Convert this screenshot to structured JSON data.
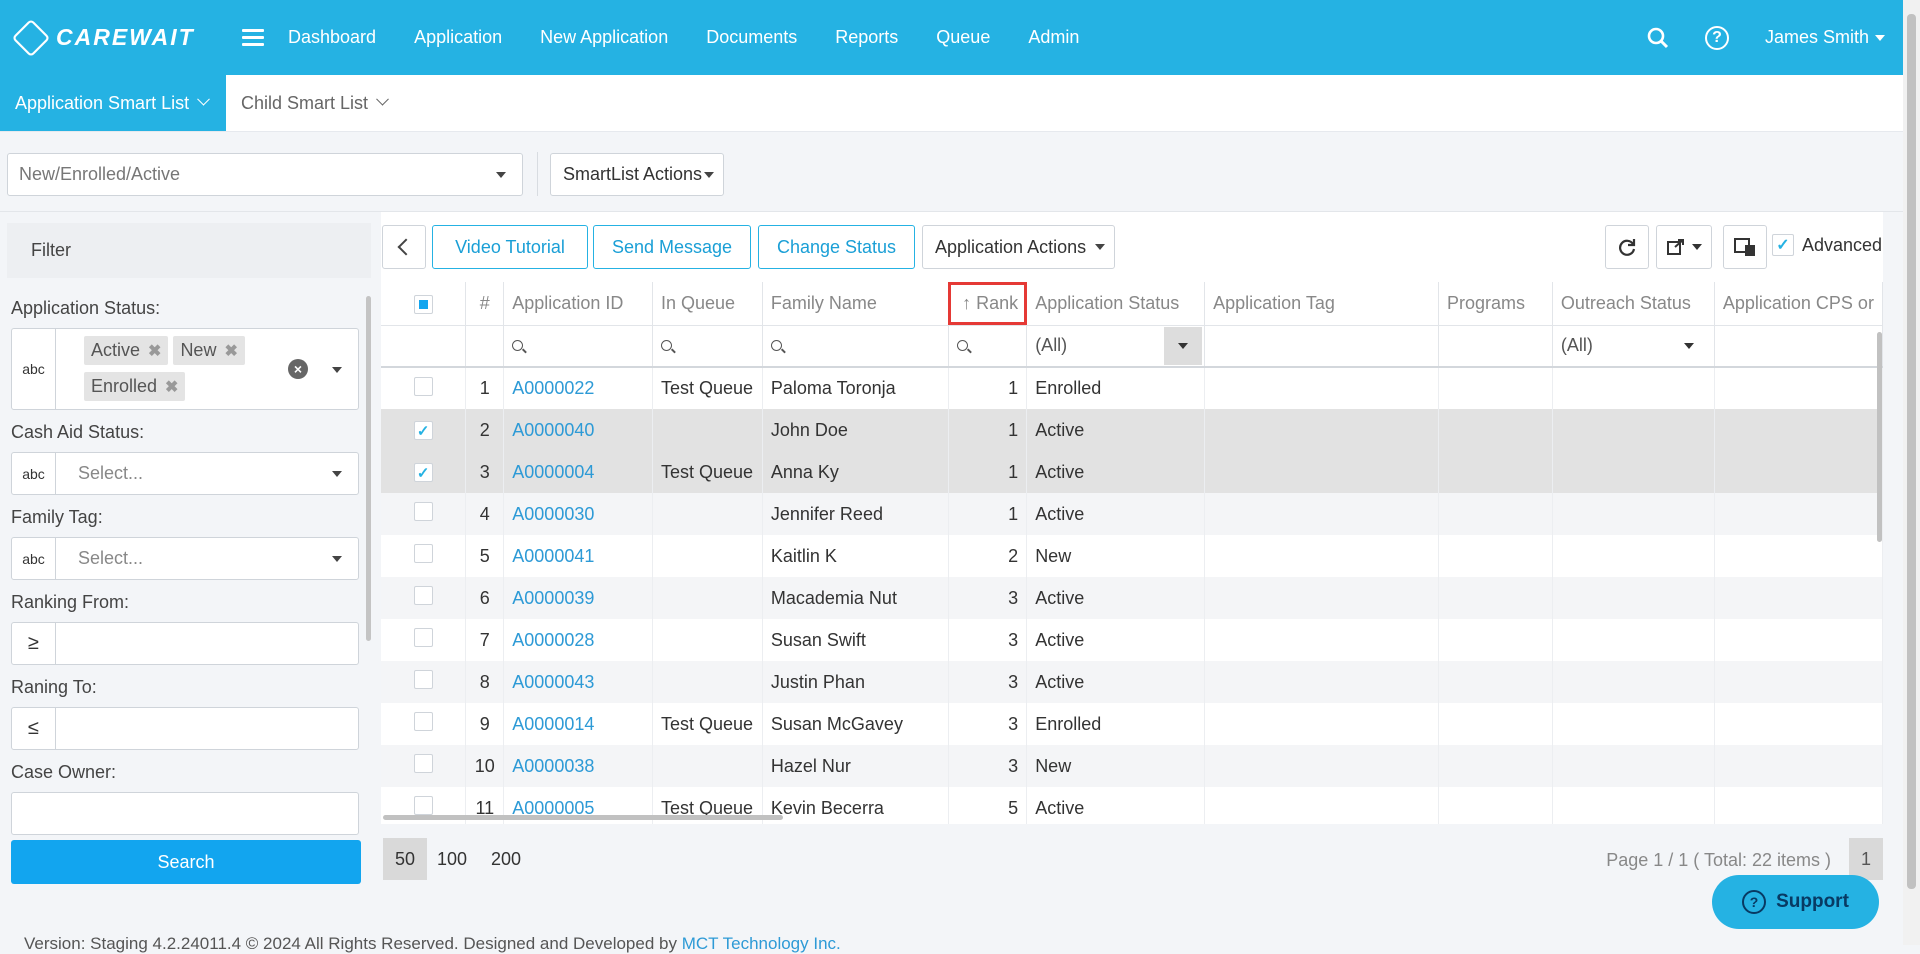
{
  "brand": {
    "name": "CAREWAIT"
  },
  "nav": {
    "items": [
      "Dashboard",
      "Application",
      "New Application",
      "Documents",
      "Reports",
      "Queue",
      "Admin"
    ],
    "user": "James Smith"
  },
  "tabs": [
    "Application Smart List",
    "Child Smart List"
  ],
  "smartlist": {
    "selected": "New/Enrolled/Active",
    "actions_label": "SmartList Actions"
  },
  "filter": {
    "title": "Filter",
    "application_status_label": "Application Status:",
    "application_status_tags": [
      "Active",
      "New",
      "Enrolled"
    ],
    "cash_aid_label": "Cash Aid Status:",
    "cash_aid_placeholder": "Select...",
    "family_tag_label": "Family Tag:",
    "family_tag_placeholder": "Select...",
    "ranking_from_label": "Ranking From:",
    "ranking_to_label": "Raning To:",
    "case_owner_label": "Case Owner:",
    "search_label": "Search",
    "text_icon": "abc",
    "gte_icon": "≥",
    "lte_icon": "≤"
  },
  "toolbar": {
    "video_tutorial": "Video Tutorial",
    "send_message": "Send Message",
    "change_status": "Change Status",
    "application_actions": "Application Actions",
    "advanced_label": "Advanced"
  },
  "table": {
    "columns": {
      "num": "#",
      "app_id": "Application ID",
      "in_queue": "In Queue",
      "family_name": "Family Name",
      "rank": "Rank",
      "app_status": "Application Status",
      "app_tag": "Application Tag",
      "programs": "Programs",
      "outreach_status": "Outreach Status",
      "cps": "Application CPS or"
    },
    "filter_all": "(All)",
    "rows": [
      {
        "num": "1",
        "id": "A0000022",
        "queue": "Test Queue",
        "family": "Paloma Toronja",
        "rank": "1",
        "status": "Enrolled",
        "checked": false
      },
      {
        "num": "2",
        "id": "A0000040",
        "queue": "",
        "family": "John Doe",
        "rank": "1",
        "status": "Active",
        "checked": true
      },
      {
        "num": "3",
        "id": "A0000004",
        "queue": "Test Queue",
        "family": "Anna Ky",
        "rank": "1",
        "status": "Active",
        "checked": true
      },
      {
        "num": "4",
        "id": "A0000030",
        "queue": "",
        "family": "Jennifer Reed",
        "rank": "1",
        "status": "Active",
        "checked": false
      },
      {
        "num": "5",
        "id": "A0000041",
        "queue": "",
        "family": "Kaitlin K",
        "rank": "2",
        "status": "New",
        "checked": false
      },
      {
        "num": "6",
        "id": "A0000039",
        "queue": "",
        "family": "Macademia Nut",
        "rank": "3",
        "status": "Active",
        "checked": false
      },
      {
        "num": "7",
        "id": "A0000028",
        "queue": "",
        "family": "Susan Swift",
        "rank": "3",
        "status": "Active",
        "checked": false
      },
      {
        "num": "8",
        "id": "A0000043",
        "queue": "",
        "family": "Justin Phan",
        "rank": "3",
        "status": "Active",
        "checked": false
      },
      {
        "num": "9",
        "id": "A0000014",
        "queue": "Test Queue",
        "family": "Susan McGavey",
        "rank": "3",
        "status": "Enrolled",
        "checked": false
      },
      {
        "num": "10",
        "id": "A0000038",
        "queue": "",
        "family": "Hazel Nur",
        "rank": "3",
        "status": "New",
        "checked": false
      },
      {
        "num": "11",
        "id": "A0000005",
        "queue": "Test Queue",
        "family": "Kevin Becerra",
        "rank": "5",
        "status": "Active",
        "checked": false
      }
    ]
  },
  "pager": {
    "sizes": [
      "50",
      "100",
      "200"
    ],
    "active_size": "50",
    "info": "Page 1 / 1 ( Total: 22 items )",
    "page": "1"
  },
  "support": {
    "label": "Support"
  },
  "footer": {
    "text": "Version: Staging 4.2.24011.4 © 2024 All Rights Reserved. Designed and Developed by ",
    "link": "MCT Technology Inc."
  },
  "colors": {
    "brand": "#25b2e3",
    "link": "#2d9ad6",
    "highlight": "#e53935"
  }
}
